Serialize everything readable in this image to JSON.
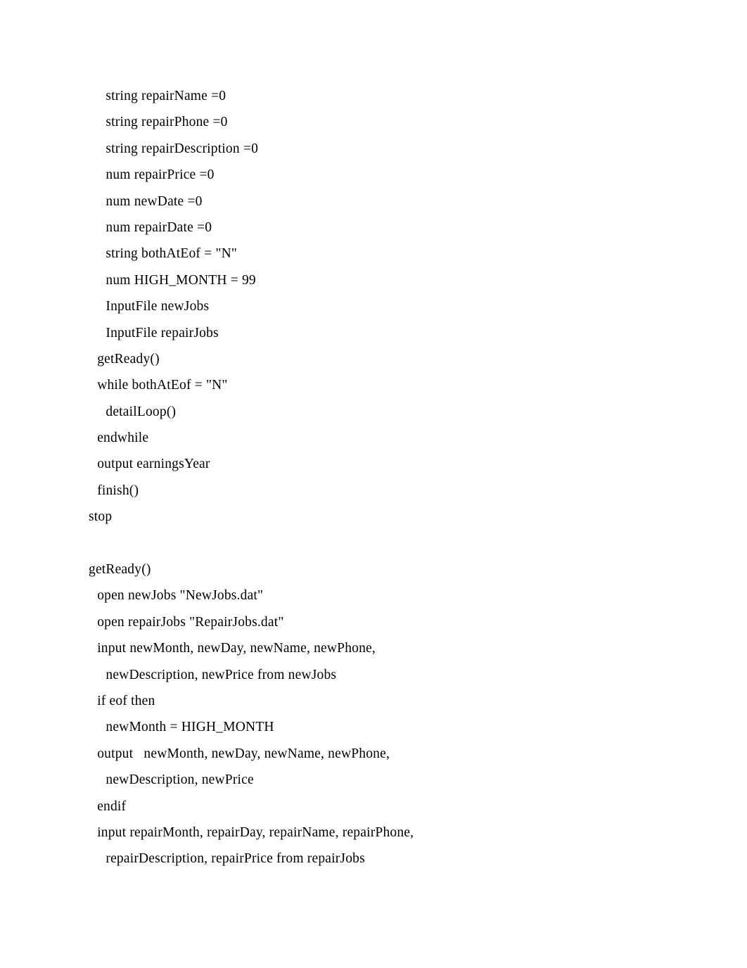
{
  "document": {
    "type": "pseudocode-listing",
    "background_color": "#ffffff",
    "text_color": "#000000",
    "lines": [
      {
        "indent": 2,
        "text": "string repairName =0"
      },
      {
        "indent": 2,
        "text": "string repairPhone =0"
      },
      {
        "indent": 2,
        "text": "string repairDescription =0"
      },
      {
        "indent": 2,
        "text": "num repairPrice =0"
      },
      {
        "indent": 2,
        "text": "num newDate =0"
      },
      {
        "indent": 2,
        "text": "num repairDate =0"
      },
      {
        "indent": 2,
        "text": "string bothAtEof = \"N\""
      },
      {
        "indent": 2,
        "text": "num HIGH_MONTH = 99"
      },
      {
        "indent": 2,
        "text": "InputFile newJobs"
      },
      {
        "indent": 2,
        "text": "InputFile repairJobs"
      },
      {
        "indent": 1,
        "text": "getReady()"
      },
      {
        "indent": 1,
        "text": "while bothAtEof = \"N\""
      },
      {
        "indent": 2,
        "text": "detailLoop()"
      },
      {
        "indent": 1,
        "text": "endwhile"
      },
      {
        "indent": 1,
        "text": "output earningsYear"
      },
      {
        "indent": 1,
        "text": "finish()"
      },
      {
        "indent": 0,
        "text": "stop"
      },
      {
        "indent": 0,
        "text": ""
      },
      {
        "indent": 0,
        "text": "getReady()"
      },
      {
        "indent": 1,
        "text": "open newJobs \"NewJobs.dat\""
      },
      {
        "indent": 1,
        "text": "open repairJobs \"RepairJobs.dat\""
      },
      {
        "indent": 1,
        "text": "input newMonth, newDay, newName, newPhone,"
      },
      {
        "indent": 2,
        "text": "newDescription, newPrice from newJobs"
      },
      {
        "indent": 1,
        "text": "if eof then"
      },
      {
        "indent": 2,
        "text": "newMonth = HIGH_MONTH"
      },
      {
        "indent": 1,
        "text": "output   newMonth, newDay, newName, newPhone,"
      },
      {
        "indent": 2,
        "text": "newDescription, newPrice"
      },
      {
        "indent": 1,
        "text": "endif"
      },
      {
        "indent": 1,
        "text": "input repairMonth, repairDay, repairName, repairPhone,"
      },
      {
        "indent": 2,
        "text": "repairDescription, repairPrice from repairJobs"
      }
    ]
  }
}
